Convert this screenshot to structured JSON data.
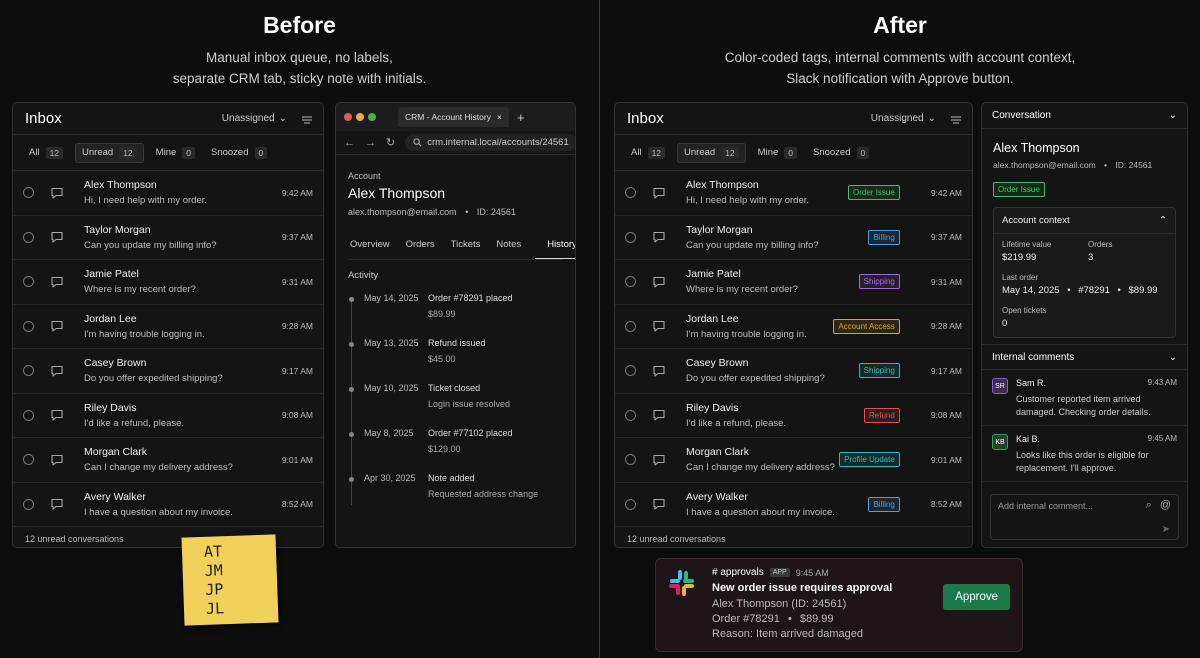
{
  "before": {
    "title": "Before",
    "subtitle_line1": "Manual inbox queue, no labels,",
    "subtitle_line2": "separate CRM tab, sticky note with initials."
  },
  "after": {
    "title": "After",
    "subtitle_line1": "Color-coded tags, internal comments with account context,",
    "subtitle_line2": "Slack notification with Approve button."
  },
  "inbox": {
    "title": "Inbox",
    "assign_filter": "Unassigned",
    "filters": [
      {
        "label": "All",
        "count": "12"
      },
      {
        "label": "Unread",
        "count": "12"
      },
      {
        "label": "Mine",
        "count": "0"
      },
      {
        "label": "Snoozed",
        "count": "0"
      }
    ],
    "rows": [
      {
        "name": "Alex Thompson",
        "msg": "Hi, I need help with my order.",
        "time": "9:42 AM",
        "tag": "Order Issue",
        "tag_color": "#3fbf6a"
      },
      {
        "name": "Taylor Morgan",
        "msg": "Can you update my billing info?",
        "time": "9:37 AM",
        "tag": "Billing",
        "tag_color": "#4a9ee8"
      },
      {
        "name": "Jamie Patel",
        "msg": "Where is my recent order?",
        "time": "9:31 AM",
        "tag": "Shipping",
        "tag_color": "#a46be0"
      },
      {
        "name": "Jordan Lee",
        "msg": "I'm having trouble logging in.",
        "time": "9:28 AM",
        "tag": "Account Access",
        "tag_color": "#e0a030"
      },
      {
        "name": "Casey Brown",
        "msg": "Do you offer expedited shipping?",
        "time": "9:17 AM",
        "tag": "Shipping",
        "tag_color": "#2fb8b0"
      },
      {
        "name": "Riley Davis",
        "msg": "I'd like a refund, please.",
        "time": "9:08 AM",
        "tag": "Refund",
        "tag_color": "#e05050"
      },
      {
        "name": "Morgan Clark",
        "msg": "Can I change my delivery address?",
        "time": "9:01 AM",
        "tag": "Profile Update",
        "tag_color": "#30b8b8"
      },
      {
        "name": "Avery Walker",
        "msg": "I have a question about my invoice.",
        "time": "8:52 AM",
        "tag": "Billing",
        "tag_color": "#4a9ee8"
      }
    ],
    "footer": "12 unread conversations"
  },
  "crm": {
    "tab_title": "CRM - Account History",
    "url": "crm.internal.local/accounts/24561",
    "label": "Account",
    "name": "Alex Thompson",
    "email": "alex.thompson@email.com",
    "id": "ID: 24561",
    "tabs": [
      "Overview",
      "Orders",
      "Tickets",
      "Notes",
      "History"
    ],
    "activity_title": "Activity",
    "activity": [
      {
        "date": "May 14, 2025",
        "title": "Order #78291 placed",
        "detail": "$89.99"
      },
      {
        "date": "May 13, 2025",
        "title": "Refund issued",
        "detail": "$45.00"
      },
      {
        "date": "May 10, 2025",
        "title": "Ticket closed",
        "detail": "Login issue resolved"
      },
      {
        "date": "May 8, 2025",
        "title": "Order #77102 placed",
        "detail": "$129.00"
      },
      {
        "date": "Apr 30, 2025",
        "title": "Note added",
        "detail": "Requested address change"
      }
    ]
  },
  "sticky": [
    "AT",
    "JM",
    "JP",
    "JL"
  ],
  "conversation": {
    "header": "Conversation",
    "name": "Alex Thompson",
    "email": "alex.thompson@email.com",
    "id": "ID: 24561",
    "tag": "Order Issue",
    "context": {
      "header": "Account context",
      "lifetime_label": "Lifetime value",
      "lifetime_value": "$219.99",
      "orders_label": "Orders",
      "orders_value": "3",
      "last_order_label": "Last order",
      "last_order_date": "May 14, 2025",
      "last_order_id": "#78291",
      "last_order_amount": "$89.99",
      "open_tickets_label": "Open tickets",
      "open_tickets_value": "0"
    },
    "comments_header": "Internal comments",
    "comments": [
      {
        "initials": "SR",
        "name": "Sam R.",
        "time": "9:43 AM",
        "text": "Customer reported item arrived damaged. Checking order details.",
        "color": "#8a5cd0"
      },
      {
        "initials": "KB",
        "name": "Kai B.",
        "time": "9:45 AM",
        "text": "Looks like this order is eligible for replacement. I'll approve.",
        "color": "#3aa055"
      }
    ],
    "comment_placeholder": "Add internal comment..."
  },
  "slack": {
    "channel": "# approvals",
    "badge": "APP",
    "time": "9:45 AM",
    "title": "New order issue requires approval",
    "line1": "Alex Thompson (ID: 24561)",
    "line2_order": "Order #78291",
    "line2_amount": "$89.99",
    "line3": "Reason: Item arrived damaged",
    "approve": "Approve"
  }
}
